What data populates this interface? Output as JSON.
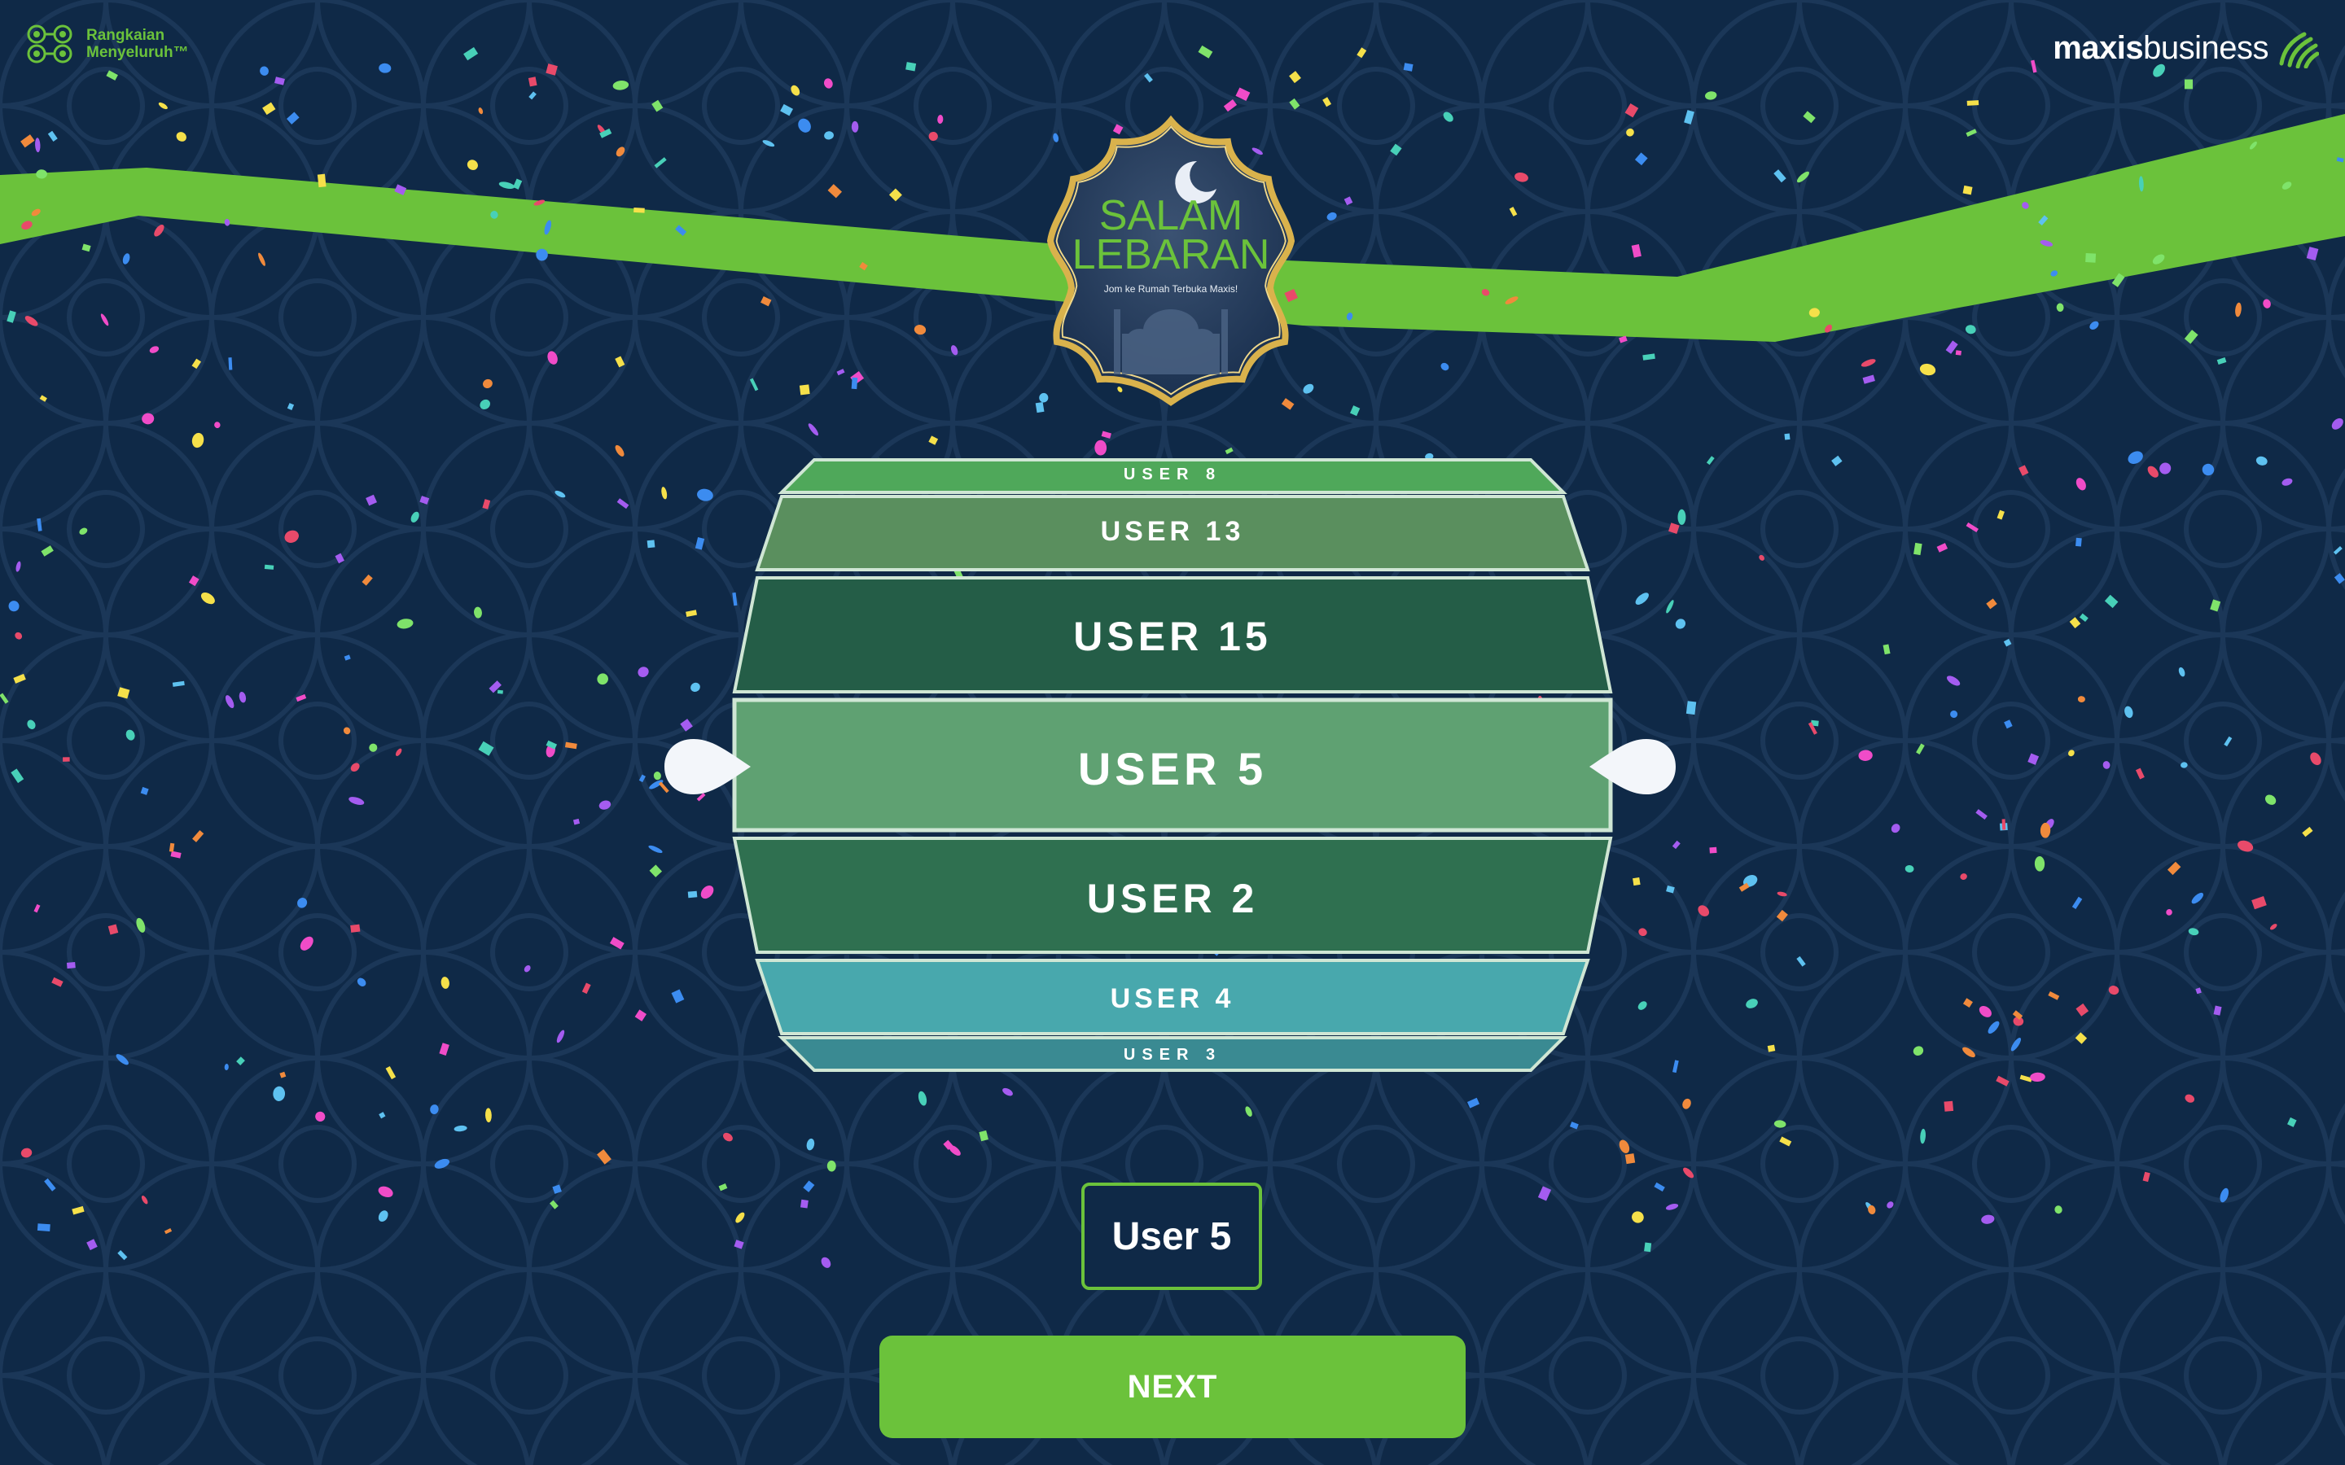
{
  "brand_left": {
    "line1": "Rangkaian",
    "line2": "Menyeluruh™"
  },
  "brand_right": {
    "bold": "maxis",
    "light": "business"
  },
  "badge": {
    "title_line1": "SALAM",
    "title_line2": "LEBARAN",
    "subtitle": "Jom ke Rumah Terbuka Maxis!"
  },
  "wheel": {
    "entries": [
      "USER 8",
      "USER 13",
      "USER 15",
      "USER 5",
      "USER 2",
      "USER 4",
      "USER 3"
    ],
    "selected_index": 3
  },
  "result": {
    "label": "User 5"
  },
  "next_button": {
    "label": "NEXT"
  },
  "colors": {
    "background": "#0f2947",
    "accent_green": "#6bc23b",
    "selected_band": "#5fa172",
    "teal_band": "#48a8ad"
  },
  "icons": [
    "wheel-pointer-left-icon",
    "wheel-pointer-right-icon",
    "maxis-logo-icon",
    "network-logo-icon"
  ]
}
